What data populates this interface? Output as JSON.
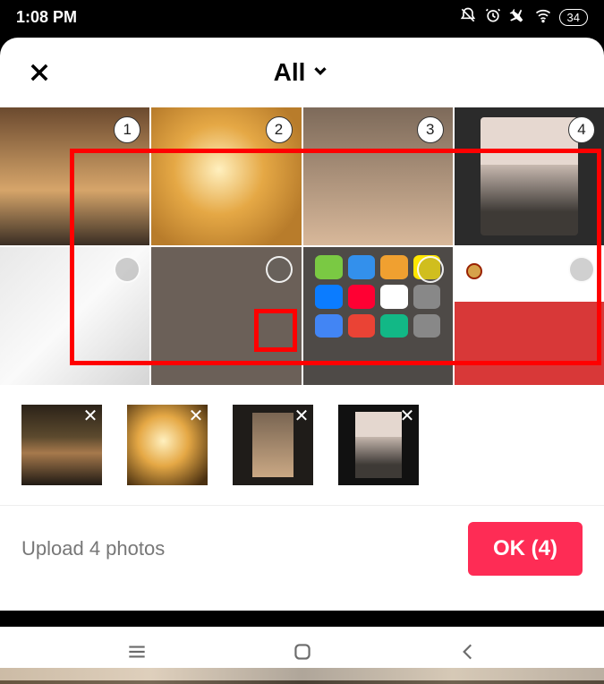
{
  "status": {
    "time": "1:08 PM",
    "battery": "34"
  },
  "header": {
    "album_label": "All"
  },
  "grid": {
    "selected_badges": [
      "1",
      "2",
      "3",
      "4"
    ]
  },
  "footer": {
    "upload_text": "Upload 4 photos",
    "ok_label": "OK (4)"
  }
}
